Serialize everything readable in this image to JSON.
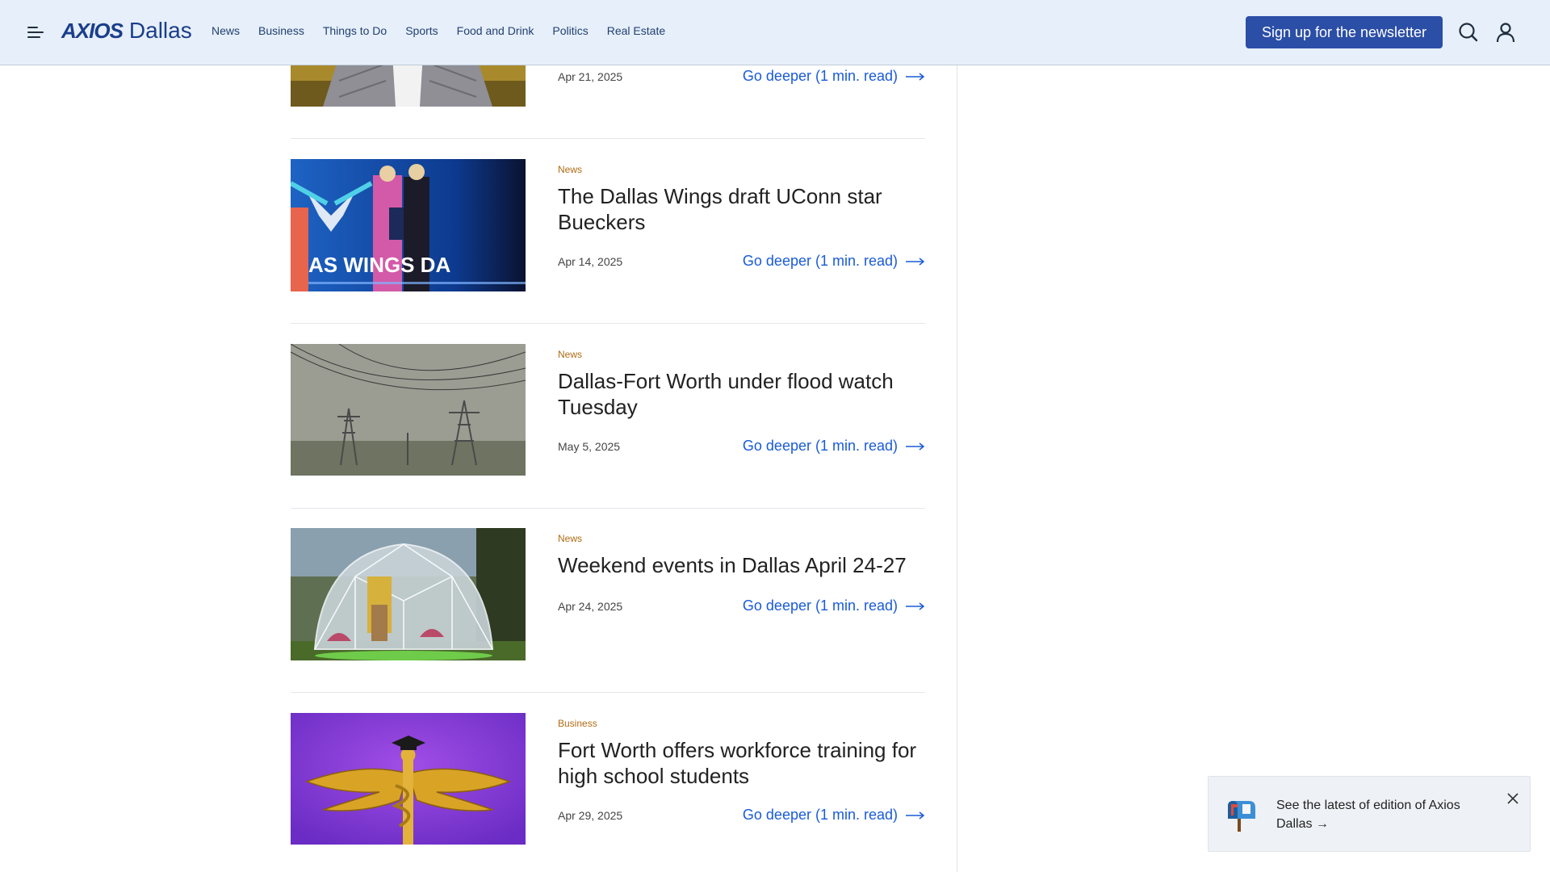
{
  "brand": {
    "name": "AXIOS",
    "city": "Dallas"
  },
  "nav": {
    "items": [
      "News",
      "Business",
      "Things to Do",
      "Sports",
      "Food and Drink",
      "Politics",
      "Real Estate"
    ]
  },
  "header": {
    "signup_label": "Sign up for the newsletter"
  },
  "articles": [
    {
      "category": "",
      "headline": "",
      "date": "Apr 21, 2025",
      "link": "Go deeper (1 min. read)"
    },
    {
      "category": "News",
      "headline": "The Dallas Wings draft UConn star Bueckers",
      "date": "Apr 14, 2025",
      "link": "Go deeper (1 min. read)",
      "image_text": "AS WINGS DA"
    },
    {
      "category": "News",
      "headline": "Dallas-Fort Worth under flood watch Tuesday",
      "date": "May 5, 2025",
      "link": "Go deeper (1 min. read)"
    },
    {
      "category": "News",
      "headline": "Weekend events in Dallas April 24-27",
      "date": "Apr 24, 2025",
      "link": "Go deeper (1 min. read)"
    },
    {
      "category": "Business",
      "headline": "Fort Worth offers workforce training for high school students",
      "date": "Apr 29, 2025",
      "link": "Go deeper (1 min. read)"
    }
  ],
  "toast": {
    "text": "See the latest of edition of Axios Dallas →"
  },
  "colors": {
    "header_bg": "#e6effa",
    "brand": "#1a3e8a",
    "button": "#2b4ea6",
    "link": "#1a5bd6",
    "category": "#b06b12"
  },
  "icons": {
    "menu": "hamburger-icon",
    "search": "search-icon",
    "account": "user-icon",
    "arrow": "arrow-right-icon",
    "close": "close-icon",
    "mailbox": "mailbox-icon"
  }
}
